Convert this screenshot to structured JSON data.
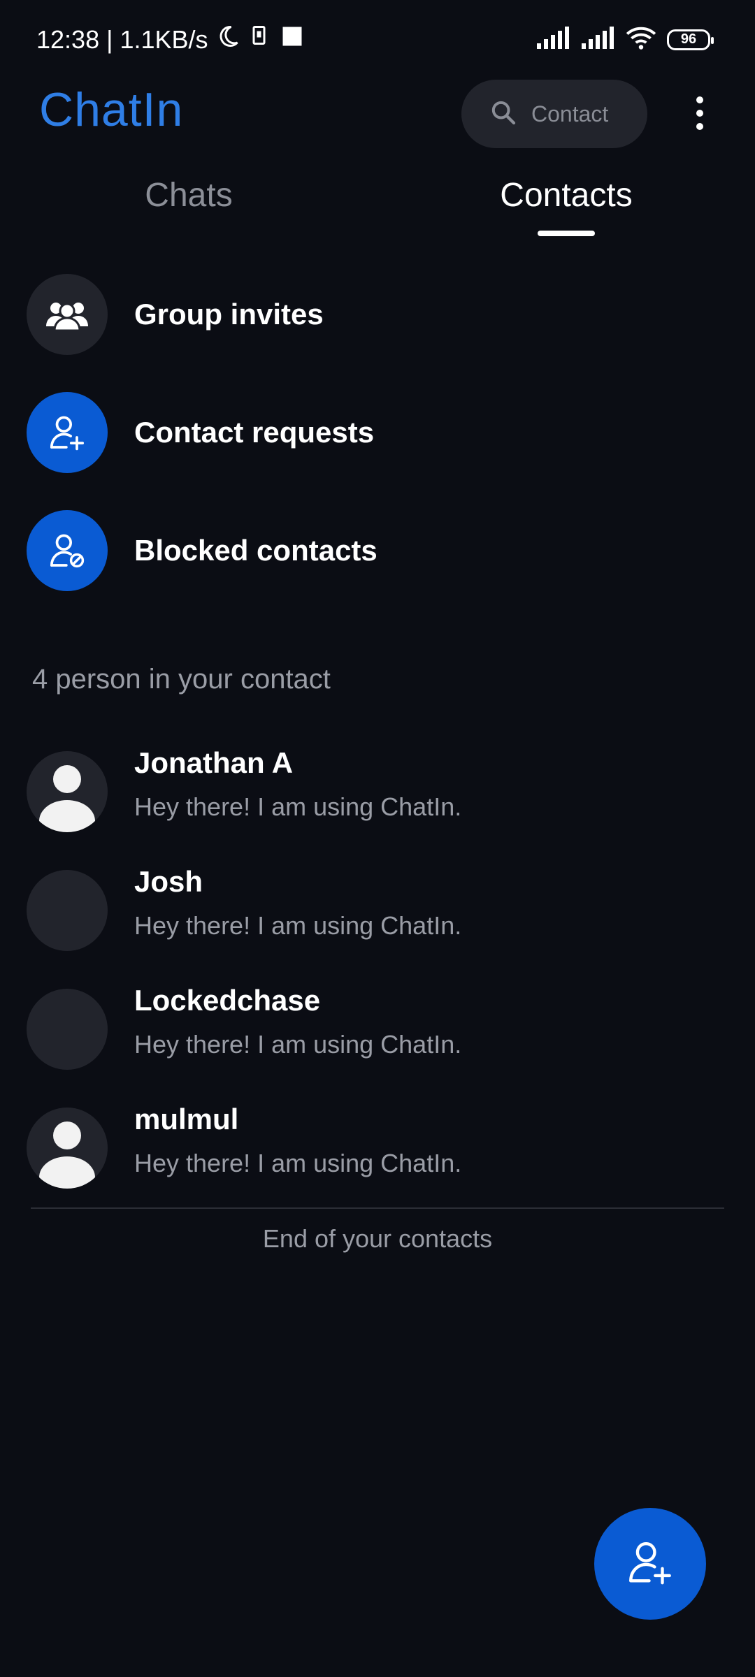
{
  "status_bar": {
    "time_speed": "12:38 | 1.1KB/s",
    "battery": "96"
  },
  "header": {
    "app_title": "ChatIn",
    "search_placeholder": "Contact"
  },
  "tabs": [
    {
      "label": "Chats",
      "active": false
    },
    {
      "label": "Contacts",
      "active": true
    }
  ],
  "actions": [
    {
      "label": "Group invites",
      "icon": "group-icon"
    },
    {
      "label": "Contact requests",
      "icon": "add-person-icon"
    },
    {
      "label": "Blocked contacts",
      "icon": "blocked-person-icon"
    }
  ],
  "contacts_section": {
    "count_label": "4 person in your contact",
    "end_label": "End of your contacts"
  },
  "contacts": [
    {
      "name": "Jonathan A",
      "status": "Hey there! I am using ChatIn.",
      "has_photo": true
    },
    {
      "name": "Josh",
      "status": "Hey there! I am using ChatIn.",
      "has_photo": false
    },
    {
      "name": "Lockedchase",
      "status": "Hey there! I am using ChatIn.",
      "has_photo": false
    },
    {
      "name": "mulmul",
      "status": "Hey there! I am using ChatIn.",
      "has_photo": true
    }
  ],
  "colors": {
    "background": "#0b0d14",
    "accent": "#2f7ee6",
    "action_blue": "#0a5bd3",
    "surface": "#22242c"
  }
}
